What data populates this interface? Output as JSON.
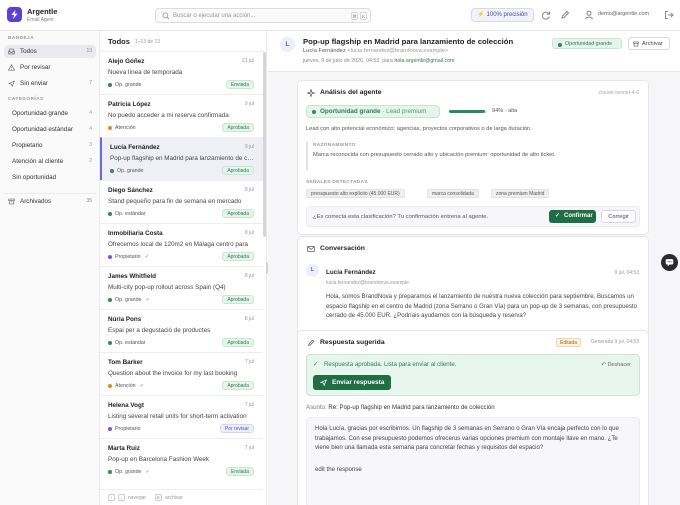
{
  "app": {
    "name": "Argentle",
    "subtitle": "Email Agent",
    "accent": "#5b3fd6"
  },
  "topbar": {
    "search_placeholder": "Buscar o ejecutar una acción...",
    "shortcut_keys": [
      "⌘",
      "K"
    ],
    "precision_label": "100% precisión",
    "icons": [
      "refresh-icon",
      "pen-icon",
      "user-icon",
      "logout-icon"
    ],
    "user_email": "demo@argentle.com"
  },
  "sidebar": {
    "inbox_title": "BANDEJA",
    "items": [
      {
        "label": "Todos",
        "count": "13",
        "icon": "inbox-icon"
      },
      {
        "label": "Por revisar",
        "count": "",
        "icon": "alert-icon"
      },
      {
        "label": "Sin enviar",
        "count": "7",
        "icon": "send-icon"
      }
    ],
    "categories_title": "CATEGORÍAS",
    "categories": [
      {
        "label": "Oportunidad grande",
        "count": "4"
      },
      {
        "label": "Oportunidad estándar",
        "count": "4"
      },
      {
        "label": "Propietario",
        "count": "3"
      },
      {
        "label": "Atención al cliente",
        "count": "2"
      },
      {
        "label": "Sin oportunidad",
        "count": ""
      }
    ],
    "archived": {
      "label": "Archivados",
      "count": "35"
    }
  },
  "list": {
    "title": "Todos",
    "range": "1–13 de 13",
    "items": [
      {
        "name": "Alejo Góñez",
        "date": "21 jul",
        "subject": "Nueva línea de temporada",
        "tag": "Op. grande",
        "tag_color": "#2b8a5a",
        "checked": false,
        "badge": "Enviada",
        "badge_type": "env"
      },
      {
        "name": "Patricia López",
        "date": "9 jul",
        "subject": "No puedo acceder a mi reserva confirmada",
        "tag": "Atención",
        "tag_color": "#e58a1f",
        "checked": false,
        "badge": "Aprobada",
        "badge_type": "apr"
      },
      {
        "name": "Lucía Fernández",
        "date": "9 jul",
        "subject": "Pop-up flagship en Madrid para lanzamiento de colección",
        "tag": "Op. grande",
        "tag_color": "#2b8a5a",
        "checked": false,
        "badge": "Aprobada",
        "badge_type": "apr"
      },
      {
        "name": "Diego Sánchez",
        "date": "8 jul",
        "subject": "Stand pequeño para fin de semana en mercado",
        "tag": "Op. estándar",
        "tag_color": "#2b8a5a",
        "checked": false,
        "badge": "Aprobada",
        "badge_type": "apr"
      },
      {
        "name": "Inmobiliaria Costa",
        "date": "8 jul",
        "subject": "Ofrecemos local de 120m2 en Málaga centro para",
        "tag": "Propietario",
        "tag_color": "#8a4fd0",
        "checked": true,
        "badge": "Aprobada",
        "badge_type": "apr"
      },
      {
        "name": "James Whitfield",
        "date": "8 jul",
        "subject": "Multi-city pop-up rollout across Spain (Q4)",
        "tag": "Op. grande",
        "tag_color": "#2b8a5a",
        "checked": true,
        "badge": "Aprobada",
        "badge_type": "apr"
      },
      {
        "name": "Núria Pons",
        "date": "8 jul",
        "subject": "Espai per a degustació de productes",
        "tag": "Op. estándar",
        "tag_color": "#2b8a5a",
        "checked": false,
        "badge": "Aprobada",
        "badge_type": "apr"
      },
      {
        "name": "Tom Barker",
        "date": "7 jul",
        "subject": "Question about the invoice for my last booking",
        "tag": "Atención",
        "tag_color": "#e58a1f",
        "checked": true,
        "badge": "Aprobada",
        "badge_type": "apr"
      },
      {
        "name": "Helena Vogt",
        "date": "7 jul",
        "subject": "Listing several retail units for short-term activation",
        "tag": "Propietario",
        "tag_color": "#8a4fd0",
        "checked": false,
        "badge": "Por revisar",
        "badge_type": "rev"
      },
      {
        "name": "Marta Ruiz",
        "date": "7 jul",
        "subject": "Pop-up en Barcelona Fashion Week",
        "tag": "Op. grande",
        "tag_color": "#2b8a5a",
        "checked": true,
        "badge": "Enviada",
        "badge_type": "env"
      }
    ],
    "footer": {
      "navegar": "navegar",
      "archivar": "archivar",
      "keys": [
        "↑",
        "↓",
        "E"
      ]
    }
  },
  "detail": {
    "avatar": "L",
    "title": "Pop-up flagship en Madrid para lanzamiento de colección",
    "from_name": "Lucía Fernández",
    "from_email": "<lucia.fernandez@brandnova.example>",
    "date": "jueves, 9 de julio de 2026, 04:53",
    "para_label": "para",
    "to": "hola.argentle@gmail.com",
    "category_badge": "Oportunidad grande",
    "archive_label": "Archivar",
    "analysis": {
      "title": "Análisis del agente",
      "model": "claude-sonnet-4-6",
      "category": "Oportunidad grande",
      "quality": "Lead premium",
      "confidence": 0.94,
      "confidence_label": "94% · alta",
      "summary": "Lead con alto potencial económico: agencias, proyectos corporativos o de larga duración.",
      "reasoning_title": "RAZONAMIENTO",
      "reasoning": "Marca reconocida con presupuesto cerrado alto y ubicación premium: oportunidad de alto ticket.",
      "signals_title": "SEÑALES DETECTADAS",
      "signals": [
        "presupuesto alto explícito (45.000 EUR)",
        "marca consolidada",
        "zona premium Madrid"
      ],
      "question": "¿Es correcta esta clasificación? Tu confirmación entrena al agente.",
      "confirm_label": "Confirmar",
      "correct_label": "Corregir"
    },
    "conversation": {
      "title": "Conversación",
      "avatar": "L",
      "from_name": "Lucía Fernández",
      "from_email": "lucia.fernandez@brandnova.example",
      "date": "9 jul, 04:53",
      "body": "Hola, somos BrandNova y preparamos el lanzamiento de nuestra nueva colección para septiembre. Buscamos un espacio flagship en el centro de Madrid (zona Serrano o Gran Vía) para un pop-up de 3 semanas, con presupuesto cerrado de 45.000 EUR. ¿Podríais ayudarnos con la búsqueda y reserva?"
    },
    "suggested": {
      "title": "Respuesta sugerida",
      "edited_badge": "Editada",
      "generated": "Generada 9 jul, 04:53",
      "approved_text": "Respuesta aprobada. Lista para enviar al cliente.",
      "undo_label": "Deshacer",
      "send_label": "Enviar respuesta",
      "subject_label": "Asunto:",
      "subject": "Re: Pop-up flagship en Madrid para lanzamiento de colección",
      "body": "Hola Lucía, gracias por escribirnos. Un flagship de 3 semanas en Serrano o Gran Vía encaja perfecto con lo que trabajamos. Con ese presupuesto podemos ofrecerus varias opciones premium con montaje llave en mano. ¿Te viene bien una llamada esta semana para concretar fechas y requisitos del espacio?",
      "extra": "edit the response"
    }
  }
}
